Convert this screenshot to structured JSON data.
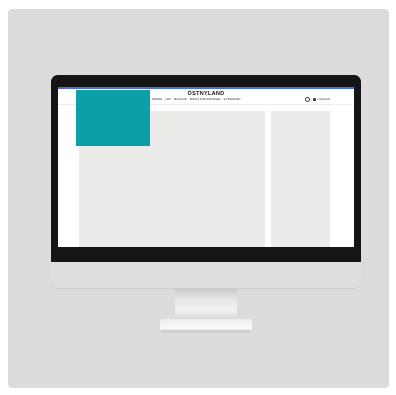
{
  "site": {
    "logo": "ÖSTNYLAND",
    "accent_color": "#4a6fd1",
    "nav": [
      {
        "label": "NEJU",
        "active": true
      },
      {
        "label": "SPORT",
        "active": false
      },
      {
        "label": "KULTUR",
        "active": false
      },
      {
        "label": "OPINION",
        "active": false
      },
      {
        "label": "CODE EFFEKTER",
        "active": false
      },
      {
        "label": "INSIDAN",
        "active": false
      },
      {
        "label": "LMO",
        "active": false
      },
      {
        "label": "BLOGGAR",
        "active": false
      },
      {
        "label": "BORGÅ FÖRSAMLINGEN",
        "active": false
      },
      {
        "label": "E-TIDNINGEN",
        "active": false
      }
    ],
    "search_icon": "search-icon",
    "login_label": "LOGGA IN",
    "user_icon": "user-icon"
  },
  "colors": {
    "panel": "#dcdcdc",
    "bezel": "#151515",
    "placeholder": "#ebebe9",
    "media": "#0c9fa8"
  }
}
